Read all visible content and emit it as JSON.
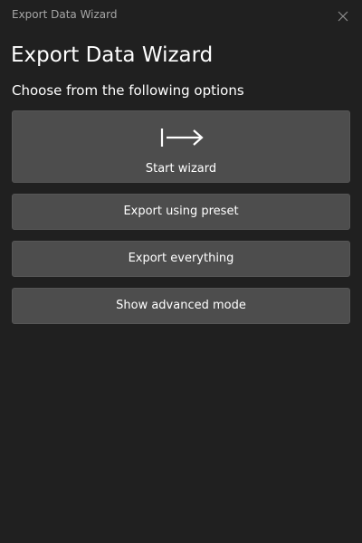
{
  "window": {
    "title": "Export Data Wizard",
    "close_icon": "close-icon"
  },
  "page": {
    "heading": "Export Data Wizard",
    "subheading": "Choose from the following options"
  },
  "options": {
    "start_wizard": {
      "label": "Start wizard",
      "icon": "arrow-right-to-bar-icon"
    },
    "export_preset": {
      "label": "Export using preset"
    },
    "export_everything": {
      "label": "Export everything"
    },
    "advanced_mode": {
      "label": "Show advanced mode"
    }
  },
  "colors": {
    "background": "#202020",
    "button": "#4d4d4d",
    "text": "#ffffff",
    "title_text": "#a6a6a6"
  }
}
